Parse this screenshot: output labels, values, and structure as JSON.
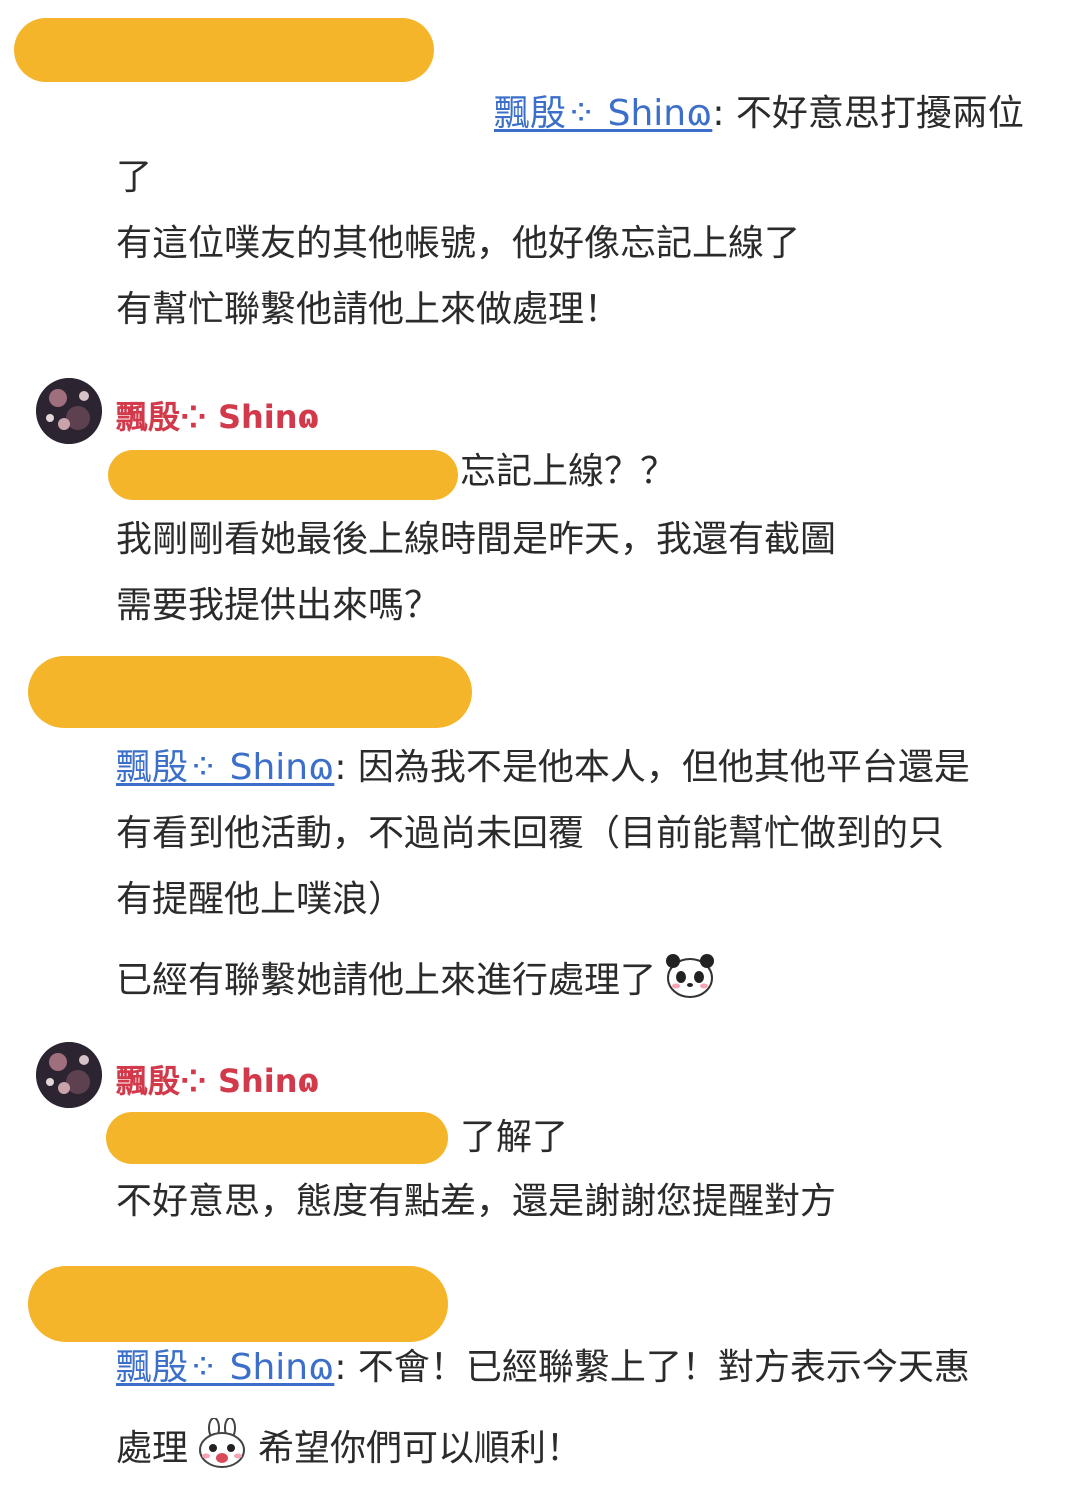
{
  "messages": [
    {
      "mention": "飄殷⁘ Shinɷ",
      "lines": [
        "不好意思打擾兩位",
        "了",
        "有這位噗友的其他帳號，他好像忘記上線了",
        "有幫忙聯繫他請他上來做處理！"
      ]
    },
    {
      "author": "飄殷⁘ Shinɷ",
      "lines": [
        "忘記上線？？",
        "我剛剛看她最後上線時間是昨天，我還有截圖",
        "需要我提供出來嗎？"
      ]
    },
    {
      "mention": "飄殷⁘ Shinɷ",
      "lines": [
        "因為我不是他本人，但他其他平台還是",
        "有看到他活動，不過尚未回覆（目前能幫忙做到的只",
        "有提醒他上噗浪）",
        "已經有聯繫她請他上來進行處理了"
      ],
      "emoji": "panda-emoji"
    },
    {
      "author": "飄殷⁘ Shinɷ",
      "lines": [
        "了解了",
        "不好意思，態度有點差，還是謝謝您提醒對方"
      ]
    },
    {
      "mention": "飄殷⁘ Shinɷ",
      "lines": [
        ": 不會！已經聯繫上了！對方表示今天惠",
        "處理",
        "希望你們可以順利！"
      ],
      "emoji": "rabbit-emoji"
    }
  ],
  "colors": {
    "redaction": "#f5b52a",
    "mention": "#3b6fc9",
    "author": "#d23a4c"
  }
}
